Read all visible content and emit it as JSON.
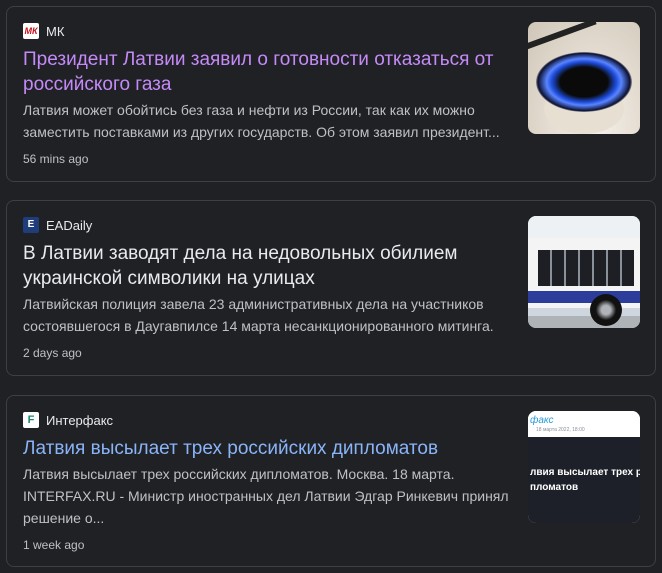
{
  "articles": [
    {
      "source": "МК",
      "logo_text": "МК",
      "title": "Президент Латвии заявил о готовности отказаться от российского газа",
      "snippet": "Латвия может обойтись без газа и нефти из России, так как их можно заместить поставками из других государств. Об этом заявил президент...",
      "time": "56 mins ago",
      "thumbnail": "gas-burner-flame"
    },
    {
      "source": "EADaily",
      "logo_text": "E",
      "title": "В Латвии заводят дела на недовольных обилием украинской символики на улицах",
      "snippet": "Латвийская полиция завела 23 административных дела на участников состоявшегося в Даугавпилсе 14 марта несанкционированного митинга.",
      "time": "2 days ago",
      "thumbnail": "trolleybus"
    },
    {
      "source": "Интерфакс",
      "logo_text": "F",
      "title": "Латвия высылает трех российских дипломатов",
      "snippet": "Латвия высылает трех российских дипломатов. Москва. 18 марта. INTERFAX.RU - Министр иностранных дел Латвии Эдгар Ринкевич принял решение о...",
      "time": "1 week ago",
      "thumbnail": "interfax-headline",
      "thumb_brand": "факс",
      "thumb_date": "18 марта 2022, 18:00",
      "thumb_headline": "лвия высылает трех р\nпломатов"
    }
  ],
  "colors": {
    "background": "#202124",
    "visited_title": "#c58af9",
    "link_title": "#8ab4f8",
    "plain_title": "#e8eaed",
    "snippet": "#bdc1c6"
  }
}
